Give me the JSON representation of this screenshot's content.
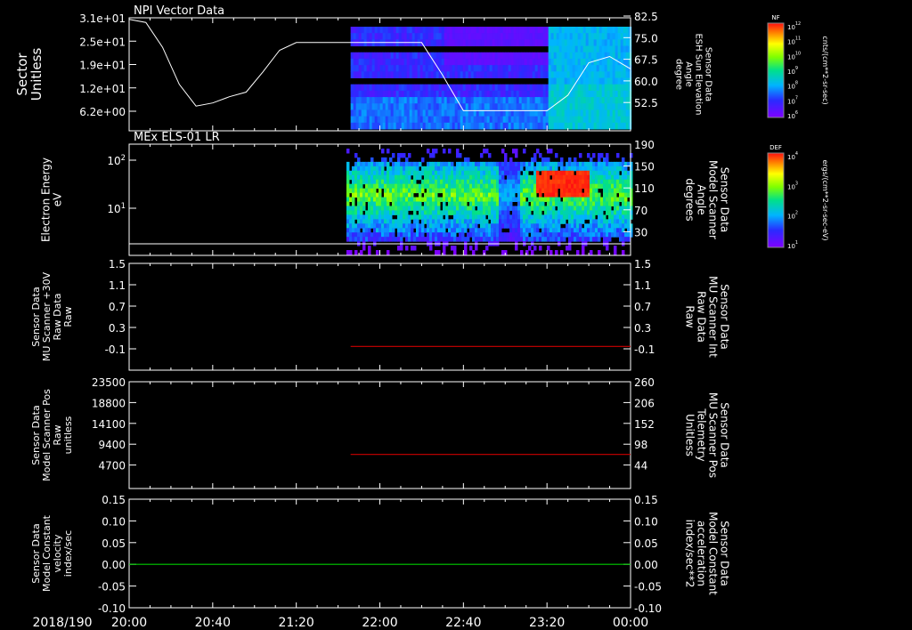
{
  "colors": {
    "background": "#000000",
    "axes": "#ffffff",
    "red_trace": "#cc0000",
    "green_trace": "#00cc00"
  },
  "footer": {
    "date": "2018/190"
  },
  "time_axis": {
    "ticks": [
      "20:00",
      "20:40",
      "21:20",
      "22:00",
      "22:40",
      "23:20",
      "00:00"
    ]
  },
  "chart_data": [
    {
      "type": "heatmap",
      "title": "NPI Vector Data",
      "ylabel": "Sector\nUnitless",
      "y_ticks": [
        "3.1e+01",
        "2.5e+01",
        "1.9e+01",
        "1.2e+01",
        "6.2e+00"
      ],
      "y2label": "Sensor Data\nESH Sun Elevation\nAngle\ndegree",
      "y2_ticks": [
        "82.5",
        "75.0",
        "67.5",
        "60.0",
        "52.5"
      ],
      "y2lim": [
        46,
        82.5
      ],
      "colorbar": {
        "label": "NF",
        "units": "cnts/(cm**2-sr-sec)",
        "ticks": [
          "10^12",
          "10^11",
          "10^10",
          "10^9",
          "10^8",
          "10^7",
          "10^6"
        ]
      },
      "overlay_line": {
        "name": "ESH Sun Elevation Angle",
        "x": [
          "20:00",
          "20:08",
          "20:16",
          "20:24",
          "20:32",
          "20:40",
          "20:48",
          "20:56",
          "21:04",
          "21:12",
          "21:20",
          "21:40",
          "22:00",
          "22:10",
          "22:20",
          "22:30",
          "22:40",
          "23:00",
          "23:20",
          "23:30",
          "23:40",
          "23:50",
          "00:00"
        ],
        "values": [
          82,
          81,
          73,
          61,
          54,
          55,
          57,
          58.5,
          65,
          72,
          74.5,
          74.5,
          74.5,
          74.5,
          74.5,
          64,
          52.5,
          52.5,
          52.5,
          57.5,
          68,
          70,
          66
        ]
      }
    },
    {
      "type": "heatmap",
      "title": "MEx ELS-01 LR",
      "ylabel": "Electron Energy\neV",
      "y_ticks": [
        "10^2",
        "10^1"
      ],
      "y2label": "Sensor Data\nModel Scanner\nAngle\ndegrees",
      "y2_ticks": [
        "190",
        "150",
        "110",
        "70",
        "30"
      ],
      "colorbar": {
        "label": "DEF",
        "units": "ergs/(cm**2-sr-sec-eV)",
        "ticks": [
          "10^4",
          "10^3",
          "10^2",
          "10^1"
        ]
      }
    },
    {
      "type": "line",
      "ylabel": "Sensor Data\nMU Scanner +30V\nRaw Data\nRaw",
      "y_ticks": [
        "1.5",
        "1.1",
        "0.7",
        "0.3",
        "-0.1"
      ],
      "ylim": [
        -0.3,
        1.5
      ],
      "y2label": "Sensor Data\nMU Scanner Int\nRaw Data\nRaw",
      "y2_ticks": [
        "1.5",
        "1.1",
        "0.7",
        "0.3",
        "-0.1"
      ],
      "series": [
        {
          "axis": "right",
          "x_start": "21:46",
          "x_end": "00:00",
          "value": 0.1
        }
      ]
    },
    {
      "type": "line",
      "ylabel": "Sensor Data\nModel Scanner Pos\nRaw\nunitless",
      "y_ticks": [
        "23500",
        "18800",
        "14100",
        "9400",
        "4700"
      ],
      "ylim": [
        0,
        23500
      ],
      "y2label": "Sensor Data\nMU Scanner Pos\nTelemetry\nUnitless",
      "y2_ticks": [
        "260",
        "206",
        "152",
        "98",
        "44"
      ],
      "y2lim": [
        0,
        260
      ],
      "series": [
        {
          "axis": "right",
          "x_start": "21:46",
          "x_end": "00:00",
          "value": 83
        }
      ]
    },
    {
      "type": "line",
      "ylabel": "Sensor Data\nModel Constant\nvelocity\nindex/sec",
      "y_ticks": [
        "0.15",
        "0.10",
        "0.05",
        "0.00",
        "-0.05",
        "-0.10"
      ],
      "ylim": [
        -0.1,
        0.15
      ],
      "y2label": "Sensor Data\nModel Constant\nacceleration\nindex/sec**2",
      "y2_ticks": [
        "0.15",
        "0.10",
        "0.05",
        "0.00",
        "-0.05",
        "-0.10"
      ],
      "series": [
        {
          "axis": "left",
          "x_start": "20:00",
          "x_end": "00:00",
          "value": 0.0
        }
      ]
    }
  ]
}
